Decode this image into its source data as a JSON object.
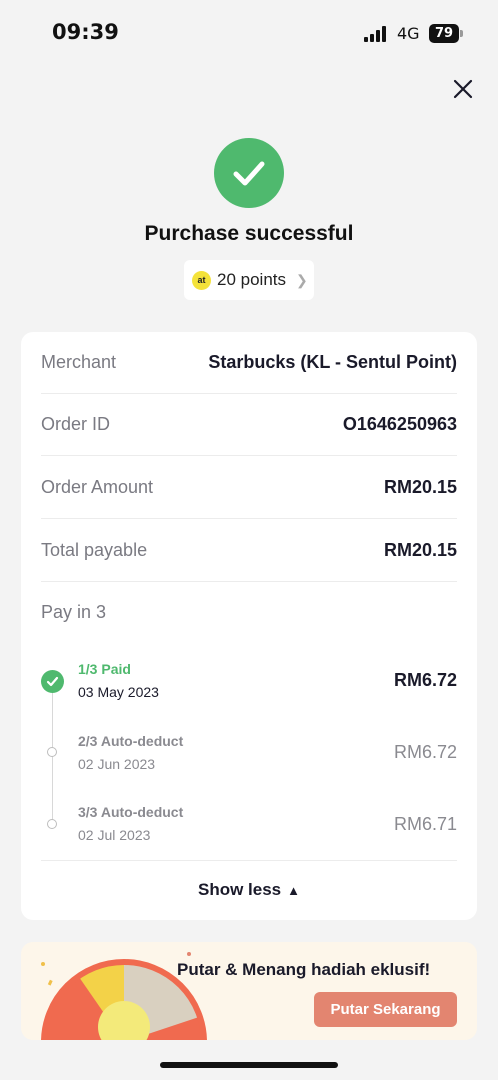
{
  "status_bar": {
    "time": "09:39",
    "network": "4G",
    "battery": "79"
  },
  "header": {
    "title": "Purchase successful",
    "points": "20 points",
    "points_coin": "at"
  },
  "details": [
    {
      "label": "Merchant",
      "value": "Starbucks (KL - Sentul Point)"
    },
    {
      "label": "Order ID",
      "value": "O1646250963"
    },
    {
      "label": "Order Amount",
      "value": "RM20.15"
    },
    {
      "label": "Total payable",
      "value": "RM20.15"
    }
  ],
  "pay_in_3": {
    "label": "Pay in 3",
    "installments": [
      {
        "status": "1/3 Paid",
        "date": "03 May 2023",
        "amount": "RM6.72"
      },
      {
        "status": "2/3 Auto-deduct",
        "date": "02 Jun 2023",
        "amount": "RM6.72"
      },
      {
        "status": "3/3 Auto-deduct",
        "date": "02 Jul 2023",
        "amount": "RM6.71"
      }
    ]
  },
  "show_less": "Show less",
  "promo": {
    "text": "Putar & Menang hadiah eklusif!",
    "button": "Putar Sekarang"
  },
  "colors": {
    "success": "#4fb96e",
    "promo_button": "#e38570",
    "paid_text": "#4fb96e"
  },
  "icons": {
    "close": "close-icon",
    "success": "check-icon",
    "coin": "points-coin-icon"
  }
}
